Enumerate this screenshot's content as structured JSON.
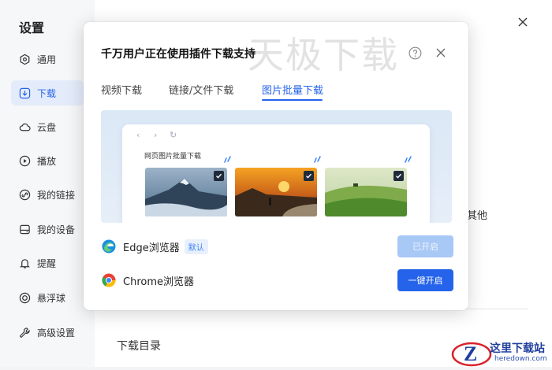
{
  "settings": {
    "title": "设置",
    "nav": [
      {
        "label": "通用",
        "icon": "general-icon"
      },
      {
        "label": "下载",
        "icon": "download-icon",
        "active": true
      },
      {
        "label": "云盘",
        "icon": "cloud-icon"
      },
      {
        "label": "播放",
        "icon": "play-icon"
      },
      {
        "label": "我的链接",
        "icon": "link-icon"
      },
      {
        "label": "我的设备",
        "icon": "device-icon"
      },
      {
        "label": "提醒",
        "icon": "bell-icon"
      },
      {
        "label": "悬浮球",
        "icon": "float-ball-icon"
      },
      {
        "label": "高级设置",
        "icon": "wrench-icon"
      }
    ],
    "partial_text": "其他",
    "download_dir_label": "下载目录"
  },
  "dialog": {
    "title": "千万用户正在使用插件下载支持",
    "watermark": "天极下载",
    "tabs": [
      {
        "label": "视频下载"
      },
      {
        "label": "链接/文件下载"
      },
      {
        "label": "图片批量下载",
        "active": true
      }
    ],
    "preview": {
      "caption": "网页图片批量下载",
      "nav_back": "‹",
      "nav_forward": "›",
      "nav_refresh": "↻"
    },
    "browsers": [
      {
        "name": "Edge浏览器",
        "badge": "默认",
        "button": "已开启",
        "button_state": "disabled",
        "icon": "edge-icon"
      },
      {
        "name": "Chrome浏览器",
        "badge": "",
        "button": "一键开启",
        "button_state": "primary",
        "icon": "chrome-icon"
      }
    ]
  },
  "branding": {
    "site_name": "这里下载站",
    "site_url": "heredown.com"
  },
  "colors": {
    "accent": "#2563eb",
    "disabled_button": "#a8c8f5",
    "sidebar_bg": "#f6f7f9"
  }
}
